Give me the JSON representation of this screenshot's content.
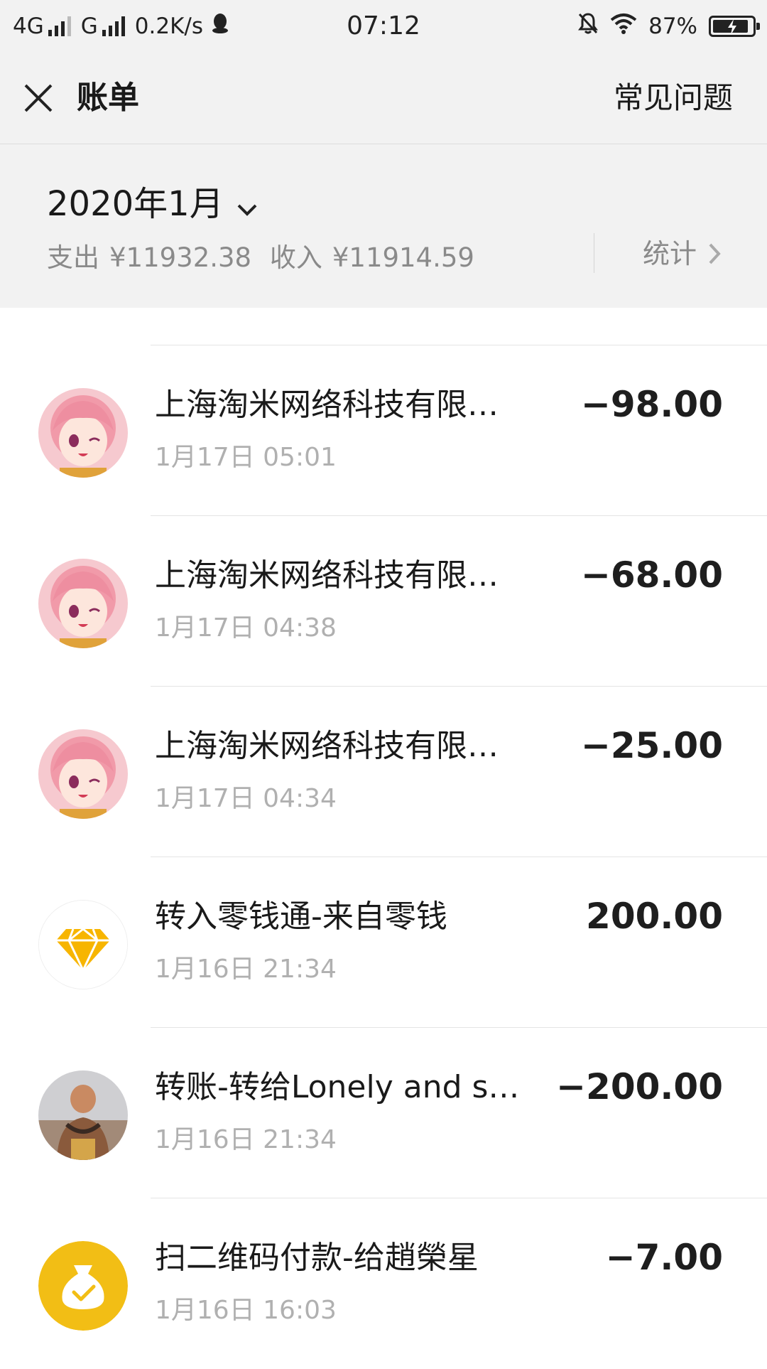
{
  "status_bar": {
    "network1": "4G",
    "network2": "G",
    "speed": "0.2K/s",
    "time": "07:12",
    "battery": "87%"
  },
  "header": {
    "title": "账单",
    "faq_label": "常见问题"
  },
  "summary": {
    "month": "2020年1月",
    "expense_label": "支出",
    "expense_value": "¥11932.38",
    "income_label": "收入",
    "income_value": "¥11914.59",
    "stats_label": "统计"
  },
  "transactions": [
    {
      "name": "上海淘米网络科技有限…",
      "time": "1月17日 05:01",
      "amount": "−98.00",
      "avatar": "anime-girl-avatar"
    },
    {
      "name": "上海淘米网络科技有限…",
      "time": "1月17日 04:38",
      "amount": "−68.00",
      "avatar": "anime-girl-avatar"
    },
    {
      "name": "上海淘米网络科技有限…",
      "time": "1月17日 04:34",
      "amount": "−25.00",
      "avatar": "anime-girl-avatar"
    },
    {
      "name": "转入零钱通-来自零钱",
      "time": "1月16日 21:34",
      "amount": "200.00",
      "avatar": "diamond-icon"
    },
    {
      "name": "转账-转给Lonely and s…",
      "time": "1月16日 21:34",
      "amount": "−200.00",
      "avatar": "person-photo-avatar"
    },
    {
      "name": "扫二维码付款-给趙榮星",
      "time": "1月16日 16:03",
      "amount": "−7.00",
      "avatar": "money-bag-icon"
    }
  ]
}
